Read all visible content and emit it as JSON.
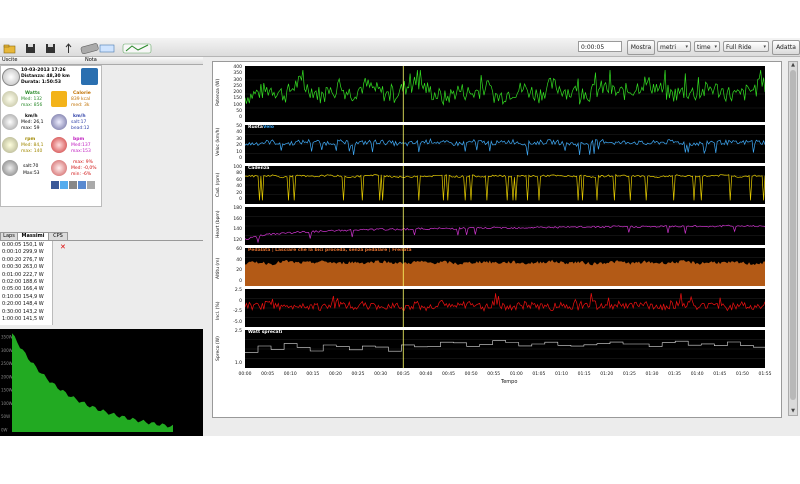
{
  "toolbar": {
    "buttons": [
      {
        "name": "open-folder-icon"
      },
      {
        "name": "save-icon"
      },
      {
        "name": "save-as-icon"
      },
      {
        "name": "upload-icon"
      },
      {
        "name": "device-icon"
      },
      {
        "name": "sync-icon"
      },
      {
        "name": "strava-icon"
      }
    ],
    "time_value": "0:00:05",
    "show_button": "Mostra",
    "unit_select": "metri",
    "xaxis_select": "time",
    "range_select": "Full Ride",
    "fit_button": "Adatta"
  },
  "rides": {
    "col1": "Uscite",
    "col2": "Nota"
  },
  "summary": {
    "date": "10-03-2013 17:26",
    "distance": "Distanza: 48,30 km",
    "duration": "Durata: 1:50:53",
    "watts_label": "Watts",
    "watts_avg": "Med: 132",
    "watts_max": "max: 856",
    "calorie_label": "Calorie",
    "calorie_value": "839 kcal",
    "calorie_extra": "med: 3k",
    "speed_label": "km/h",
    "speed_avg": "Med: 26,1",
    "speed_max": "max: 59",
    "lift_label": "km/h",
    "lift_avg": "salt:17",
    "lift_max": "bead:12",
    "cad_label": "rpm",
    "cad_avg": "Med: 84,1",
    "cad_max": "max: 140",
    "hr_label": "bpm",
    "hr_avg": "Med:137",
    "hr_max": "max:153",
    "alt_up": "salt:70",
    "alt_max": "Max:53",
    "grade_max": "max: 9%",
    "grade_med": "Med: -0,0%",
    "grade_min": "min: -6%"
  },
  "tabs": [
    {
      "label": "Laps"
    },
    {
      "label": "Massimi"
    },
    {
      "label": "CPS"
    }
  ],
  "max_list": [
    "0:00:05 150,1 W",
    "0:00:10 299,9 W",
    "0:00:20 276,7 W",
    "0:00:30 263,0 W",
    "0:01:00 222,7 W",
    "0:02:00 188,6 W",
    "0:05:00 166,4 W",
    "0:10:00 154,9 W",
    "0:20:00 148,4 W",
    "0:30:00 143,2 W",
    "1:00:00 141,5 W"
  ],
  "cp_chart": {
    "yticks": [
      "350W",
      "300W",
      "250W",
      "200W",
      "150W",
      "100W",
      "50W",
      "0W"
    ],
    "color": "#22aa22"
  },
  "panels": [
    {
      "id": "power",
      "ylabel": "Potenza (W)",
      "title": "",
      "color": "#33dd22",
      "yticks": [
        "400",
        "350",
        "300",
        "250",
        "200",
        "150",
        "100",
        "50",
        "0"
      ],
      "y": [
        0,
        400
      ],
      "values": [
        180,
        220,
        250,
        200,
        300,
        240,
        180,
        260,
        210,
        280,
        230,
        190,
        260,
        300,
        220,
        170,
        240,
        210,
        260,
        180,
        230,
        250,
        200,
        280,
        240,
        190,
        220,
        260,
        210,
        240,
        300,
        250,
        200,
        230,
        210,
        260,
        220,
        190,
        240,
        280
      ]
    },
    {
      "id": "speed",
      "ylabel": "Veloc (km/h)",
      "title": "Ruota",
      "title2": "Velo",
      "color": "#3fa9f5",
      "yticks": [
        "50",
        "40",
        "30",
        "20",
        "10",
        "0"
      ],
      "y": [
        0,
        50
      ],
      "values": [
        26,
        28,
        30,
        27,
        29,
        31,
        28,
        30,
        27,
        29,
        30,
        28,
        26,
        29,
        31,
        28,
        27,
        30,
        29,
        28,
        31,
        27,
        29,
        30,
        28,
        26,
        29,
        31,
        28,
        30,
        27,
        29,
        30,
        28,
        27,
        30,
        29,
        28,
        30,
        29
      ]
    },
    {
      "id": "cadence",
      "ylabel": "Cad. (rpm)",
      "title": "Cadenza",
      "color": "#e6cc00",
      "yticks": [
        "100",
        "80",
        "60",
        "40",
        "20",
        "0"
      ],
      "y": [
        0,
        110
      ],
      "values": [
        90,
        88,
        92,
        85,
        90,
        87,
        91,
        89,
        86,
        90,
        92,
        88,
        85,
        90,
        89,
        91,
        87,
        90,
        88,
        92,
        86,
        90,
        89,
        91,
        88,
        90,
        87,
        89,
        92,
        88,
        90,
        86,
        91,
        89,
        88,
        90,
        92,
        87,
        90,
        89
      ]
    },
    {
      "id": "heart",
      "ylabel": "Heart (bpm)",
      "title": "",
      "color": "#cc33cc",
      "yticks": [
        "180",
        "160",
        "140",
        "120"
      ],
      "y": [
        100,
        190
      ],
      "values": [
        110,
        120,
        125,
        128,
        130,
        132,
        133,
        135,
        136,
        137,
        138,
        138,
        139,
        140,
        140,
        141,
        141,
        142,
        142,
        143,
        143,
        143,
        144,
        144,
        144,
        145,
        145,
        145,
        146,
        146,
        146,
        146,
        147,
        147,
        147,
        147,
        148,
        148,
        148,
        148
      ]
    },
    {
      "id": "altitude",
      "ylabel": "Altitu (m)",
      "title": "Pedalata | Lasciare che la bici proceda, senza pedalare | Frenata",
      "color": "#b35a16",
      "yticks": [
        "60",
        "40",
        "20",
        "0"
      ],
      "y": [
        0,
        70
      ],
      "values": [
        45,
        48,
        44,
        50,
        46,
        47,
        49,
        45,
        48,
        46,
        50,
        47,
        45,
        49,
        46,
        48,
        44,
        47,
        49,
        46,
        48,
        45,
        47,
        50,
        46,
        48,
        44,
        47,
        49,
        45,
        48,
        46,
        47,
        49,
        45,
        48,
        46,
        47,
        44,
        46
      ]
    },
    {
      "id": "grade",
      "ylabel": "Incl. (%)",
      "title": "",
      "color": "#ee1111",
      "yticks": [
        "2.5",
        "0",
        "-2.5",
        "-5.0"
      ],
      "y": [
        -6,
        4
      ],
      "values": [
        0.2,
        -0.4,
        0.6,
        -0.8,
        0.3,
        0.1,
        -0.5,
        0.7,
        -0.2,
        0.4,
        -0.9,
        0.5,
        -0.3,
        0.2,
        -0.6,
        0.8,
        -0.1,
        0.3,
        -0.4,
        0.6,
        -0.7,
        0.2,
        0.1,
        -0.5,
        0.4,
        -0.2,
        0.6,
        -0.8,
        0.3,
        -0.1,
        0.5,
        -0.6,
        0.2,
        0.4,
        -0.3,
        0.7,
        -0.5,
        0.1,
        -0.2,
        0.3
      ]
    },
    {
      "id": "wasted",
      "ylabel": "Spreco (W)",
      "title": "Watt sprecati",
      "color": "#dddddd",
      "yticks": [
        "2.5",
        "1.0"
      ],
      "y": [
        0,
        3.5
      ],
      "values": [
        1.5,
        2.2,
        1.8,
        2.5,
        2.0,
        1.6,
        2.4,
        2.1,
        1.7,
        2.3,
        2.0,
        1.5,
        2.6,
        1.9,
        2.2,
        2.8,
        2.4,
        2.0,
        2.6,
        2.9,
        2.3,
        2.1,
        2.7,
        2.5,
        2.0,
        2.4,
        2.2,
        2.8,
        2.3,
        2.6,
        2.0,
        2.4,
        2.9,
        2.2,
        2.5,
        2.1,
        2.7,
        2.3,
        2.0,
        2.4
      ]
    }
  ],
  "xaxis": {
    "ticks": [
      "00:00",
      "00:05",
      "00:10",
      "00:15",
      "00:20",
      "00:25",
      "00:30",
      "00:35",
      "00:40",
      "00:45",
      "00:50",
      "00:55",
      "01:00",
      "01:05",
      "01:10",
      "01:15",
      "01:20",
      "01:25",
      "01:30",
      "01:35",
      "01:40",
      "01:45",
      "01:50",
      "01:55"
    ],
    "title": "Tempo"
  },
  "marker_color": "#ffff66"
}
